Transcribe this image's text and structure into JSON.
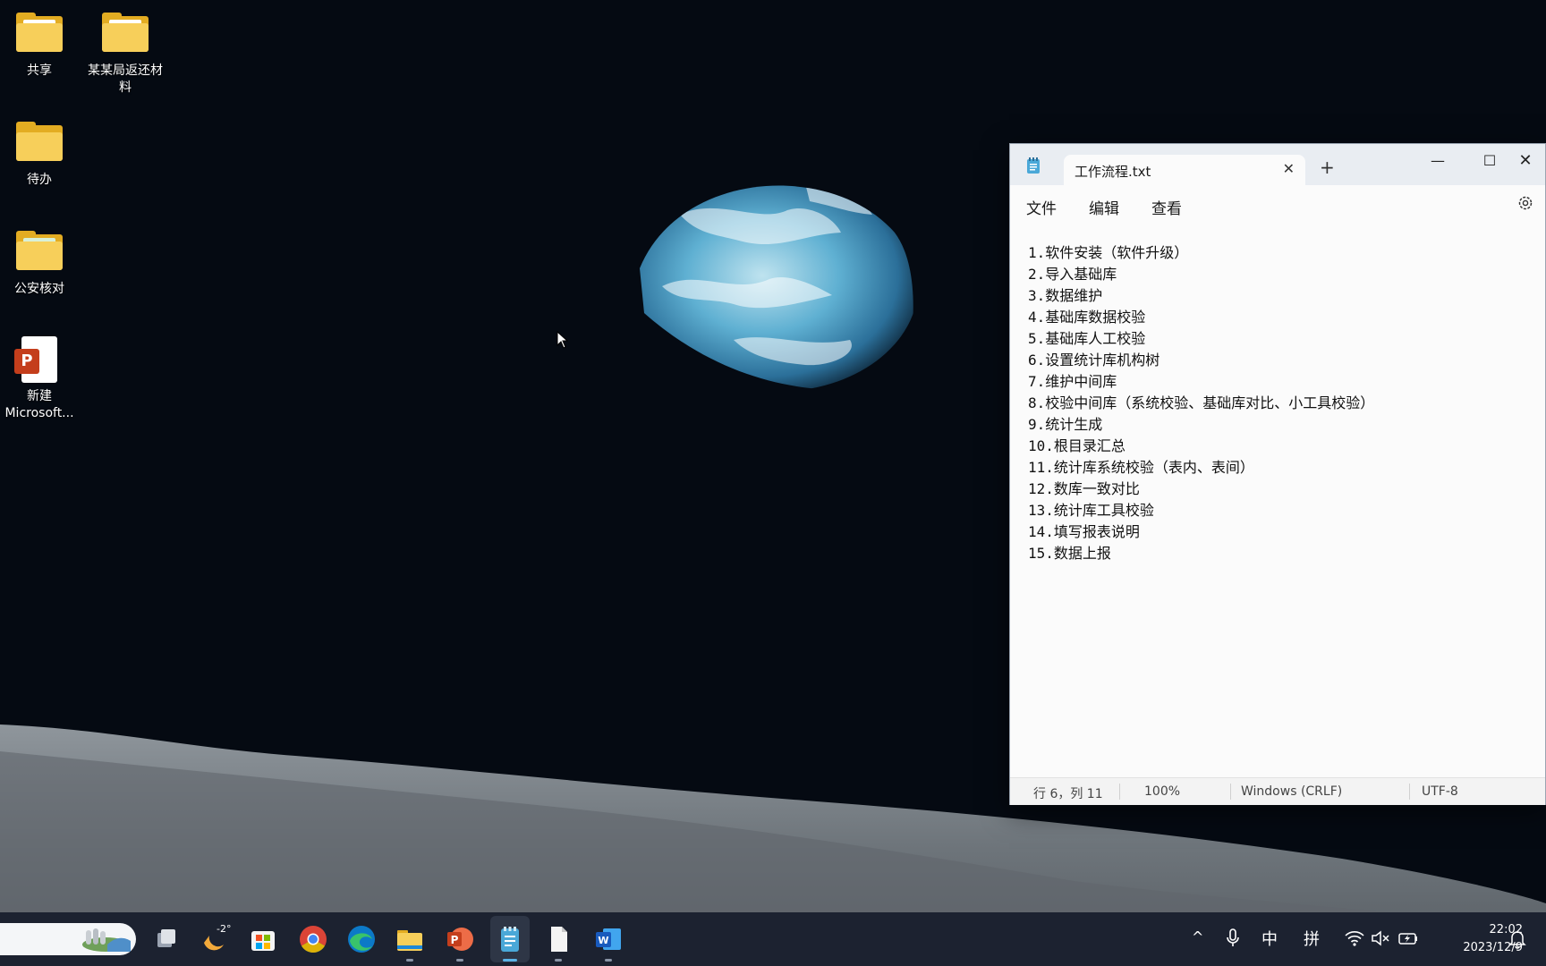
{
  "desktop": {
    "icons": [
      {
        "label": "共享",
        "type": "folder"
      },
      {
        "label": "某某局返还材料",
        "type": "folder"
      },
      {
        "label": "待办",
        "type": "folder"
      },
      {
        "label": "公安核对",
        "type": "folder"
      },
      {
        "label": "新建 Microsoft...",
        "type": "pptx"
      }
    ]
  },
  "notepad": {
    "tab_title": "工作流程.txt",
    "tab_close": "✕",
    "new_tab": "+",
    "window_min": "—",
    "window_max": "☐",
    "window_close": "✕",
    "menu": {
      "file": "文件",
      "edit": "编辑",
      "view": "查看"
    },
    "lines": [
      "1.软件安装（软件升级）",
      "2.导入基础库",
      "3.数据维护",
      "4.基础库数据校验",
      "5.基础库人工校验",
      "6.设置统计库机构树",
      "7.维护中间库",
      "8.校验中间库（系统校验、基础库对比、小工具校验）",
      "9.统计生成",
      "10.根目录汇总",
      "11.统计库系统校验（表内、表间）",
      "12.数库一致对比",
      "13.统计库工具校验",
      "14.填写报表说明",
      "15.数据上报"
    ],
    "status": {
      "position": "行 6，列 11",
      "zoom": "100%",
      "line_ending": "Windows (CRLF)",
      "encoding": "UTF-8"
    }
  },
  "taskbar": {
    "weather_temp": "-2°",
    "apps": [
      "task-view-icon",
      "weather-icon",
      "store-icon",
      "chrome-icon",
      "edge-icon",
      "file-explorer-icon",
      "powerpoint-icon",
      "notepad-icon",
      "blank-file-icon",
      "word-icon"
    ],
    "tray": {
      "chevron": "^",
      "ime_lang": "中",
      "ime_mode": "拼"
    },
    "clock": {
      "time": "22:02",
      "date": "2023/12/9"
    }
  },
  "colors": {
    "folder": "#f7cf5a",
    "taskbar": "#1c2230",
    "powerpoint": "#c43e1c",
    "word": "#185abd",
    "notepad_accent": "#4aa8d8"
  }
}
